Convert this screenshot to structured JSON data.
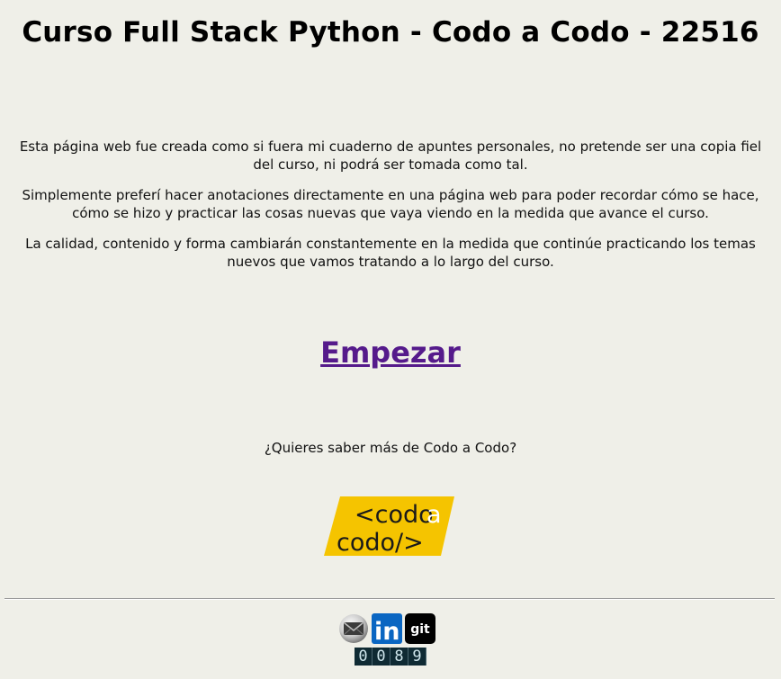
{
  "header": {
    "title": "Curso Full Stack Python - Codo a Codo - 22516"
  },
  "intro": {
    "paragraphs": [
      "Esta página web fue creada como si fuera mi cuaderno de apuntes personales, no pretende ser una copia fiel del curso, ni podrá ser tomada como tal.",
      "Simplemente preferí hacer anotaciones directamente en una página web para poder recordar cómo se hace, cómo se hizo y practicar las cosas nuevas que vaya viendo en la medida que avance el curso.",
      "La calidad, contenido y forma cambiarán constantemente en la medida que continúe practicando los temas nuevos que vamos tratando a lo largo del curso."
    ]
  },
  "start": {
    "label": "Empezar"
  },
  "promo": {
    "question": "¿Quieres saber más de Codo a Codo?",
    "logo_line1": "<codo",
    "logo_line1_accent": "a",
    "logo_line2": "codo/>",
    "logo_color": "#f5c400"
  },
  "footer": {
    "icons": [
      "mail-icon",
      "linkedin-icon",
      "git-icon"
    ],
    "git_label": "git",
    "linkedin_label": "in",
    "counter_digits": [
      "0",
      "0",
      "8",
      "9"
    ]
  },
  "colors": {
    "background": "#efefe8",
    "link_visited": "#551a8b",
    "linkedin_blue": "#0a66c2",
    "counter_bg": "#0f2a33"
  }
}
